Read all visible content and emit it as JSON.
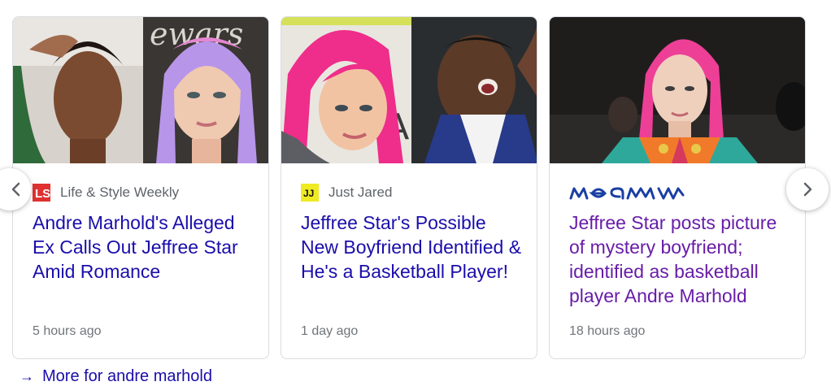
{
  "carousel": {
    "cards": [
      {
        "image": "news-thumbnail-woman-and-pink-haired-person",
        "source_icon": "life-and-style-logo-icon",
        "source": "Life & Style Weekly",
        "headline": "Andre Marhold's Alleged Ex Calls Out Jeffree Star Amid Romance",
        "time": "5 hours ago"
      },
      {
        "image": "news-thumbnail-pink-haired-person-and-basketball-player",
        "source_icon": "just-jared-logo-icon",
        "source_logo_text": "JJ",
        "source": "Just Jared",
        "headline": "Jeffree Star's Possible New Boyfriend Identified & He's a Basketball Player!",
        "time": "1 day ago"
      },
      {
        "image": "news-thumbnail-pink-haired-person-at-event",
        "source_icon": "meaww-logo-icon",
        "source": "",
        "headline": "Jeffree Star posts picture of mystery boyfriend; identified as basketball player Andre Marhold",
        "time": "18 hours ago"
      }
    ],
    "prev_icon": "chevron-left-icon",
    "next_icon": "chevron-right-icon"
  },
  "more_link": {
    "icon": "arrow-right-icon",
    "label": "More for andre marhold"
  },
  "colors": {
    "link": "#1a0dab",
    "visited": "#681da8",
    "secondary_text": "#5f6368",
    "border": "#dadce0"
  }
}
